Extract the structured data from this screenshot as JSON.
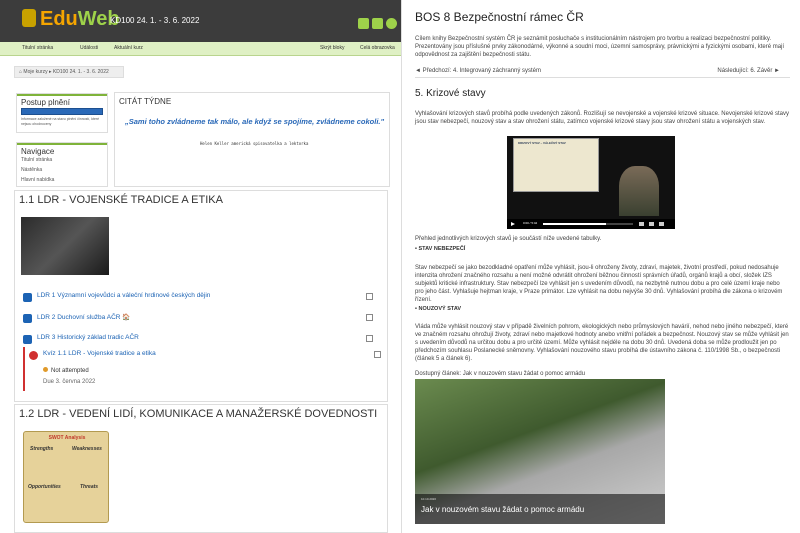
{
  "header": {
    "logo_ed": "Edu",
    "logo_web": "Web",
    "course_code": "KD100 24. 1. - 3. 6. 2022"
  },
  "menu": {
    "home": "Titulní stránka",
    "events": "Události",
    "current_course": "Aktuální kurz",
    "hide_blocks": "Skrýt bloky",
    "fullscreen": "Celá obrazovka"
  },
  "breadcrumb": {
    "my_courses": "Moje kurzy",
    "course": "KD100 24. 1. - 3. 6. 2022"
  },
  "progress_block": {
    "title": "Postup plnění",
    "note": "Informace založené na stavu plnění činností, které nejsou ohodnoceny"
  },
  "navigation_block": {
    "title": "Navigace",
    "items": [
      "Titulní stránka",
      "Nástěnka",
      "Hlavní nabídka"
    ]
  },
  "quote": {
    "title": "CITÁT TÝDNE",
    "text": "„Sami toho zvládneme tak málo, ale když se spojíme, zvládneme cokoli.\"",
    "author": "Helen Keller americká spisovatelka a lektorka"
  },
  "section1": {
    "title": "1.1 LDR - VOJENSKÉ TRADICE A ETIKA",
    "activities": [
      "LDR 1 Významní vojevůdci a váleční hrdinové českých dějin",
      "LDR 2 Duchovní služba AČR 🏠",
      "LDR 3 Historický základ tradic AČR"
    ],
    "quiz": {
      "label": "Kvíz 1.1 LDR - Vojenské tradice a etika",
      "status": "Not attempted",
      "due": "Due 3. června 2022"
    }
  },
  "section2": {
    "title": "1.2 LDR - VEDENÍ LIDÍ, KOMUNIKACE A MANAŽERSKÉ DOVEDNOSTI",
    "swot": {
      "title": "SWOT Analysis",
      "strengths": "Strengths",
      "weaknesses": "Weaknesses",
      "opportunities": "Opportunities",
      "threats": "Threats"
    }
  },
  "content": {
    "title": "BOS 8 Bezpečnostní rámec ČR",
    "intro": "Cílem knihy Bezpečnostní systém ČR je seznámit posluchače s institucionálním nástrojem pro tvorbu a realizaci bezpečnostní politiky. Prezentovány jsou příslušné prvky zákonodárné, výkonné a soudní moci, územní samosprávy, právnickými a fyzickými osobami, které mají odpovědnost za zajištění bezpečnosti státu.",
    "prev_label": "◄ Předchozí: 4. Integrovaný záchranný systém",
    "next_label": "Následující: 6. Závěr ►",
    "section_heading": "5. Krizové stavy",
    "section_intro": "Vyhlašování krizových stavů probíhá podle uvedených zákonů. Rozlišují se nevojenské a vojenské krizové situace. Nevojenské krizové stavy jsou stav nebezpečí, nouzový stav a stav ohrožení státu, zatímco vojenské krizové stavy jsou stav ohrožení státu a vojenských stav.",
    "video_slide_title": "KRIZOVÝ STAV – VÁLEČNÝ STAV",
    "video_time": "0:00 / 5:42",
    "video_progress": 0.7,
    "overview_note": "Přehled jednotlivých krizových stavů je součástí níže uvedené tabulky.",
    "bullet1": "STAV NEBEZPEČÍ",
    "para1": "Stav nebezpečí se jako bezodkladné opatření může vyhlásit, jsou-li ohroženy životy, zdraví, majetek, životní prostředí, pokud nedosahuje intenzita ohrožení značného rozsahu a není možné odvrátit ohrožení běžnou činností správních úřadů, orgánů krajů a obcí, složek IZS subjektů kritické infrastruktury. Stav nebezpečí lze vyhlásit jen s uvedením důvodů, na nezbytně nutnou dobu a pro celé území kraje nebo pro jeho část. Vyhlašuje hejtman kraje, v Praze primátor. Lze vyhlásit na dobu nejvýše 30 dnů. Vyhlašování probíhá dle zákona o krizovém řízení.",
    "bullet2": "NOUZOVÝ STAV",
    "para2": "Vláda může vyhlásit nouzový stav v případě živelních pohrom, ekologických nebo průmyslových havárií, nehod nebo jiného nebezpečí, které ve značném rozsahu ohrožují životy, zdraví nebo majetkové hodnoty anebo vnitřní pořádek a bezpečnost. Nouzový stav se může vyhlásit jen s uvedením důvodů na určitou dobu a pro určité území. Může vyhlásit nejdéle na dobu 30 dnů. Uvedená doba se může prodloužit jen po předchozím souhlasu Poslanecké sněmovny. Vyhlašování nouzového stavu probíhá dle ústavního zákona č. 110/1998 Sb., o bezpečnosti (článek 5 a článek 6).",
    "article_link": "Dostupný článek: Jak v nouzovém stavu žádat o pomoc armádu",
    "photo_date": "10.10.2020",
    "photo_caption": "Jak v nouzovém stavu žádat o pomoc armádu"
  }
}
